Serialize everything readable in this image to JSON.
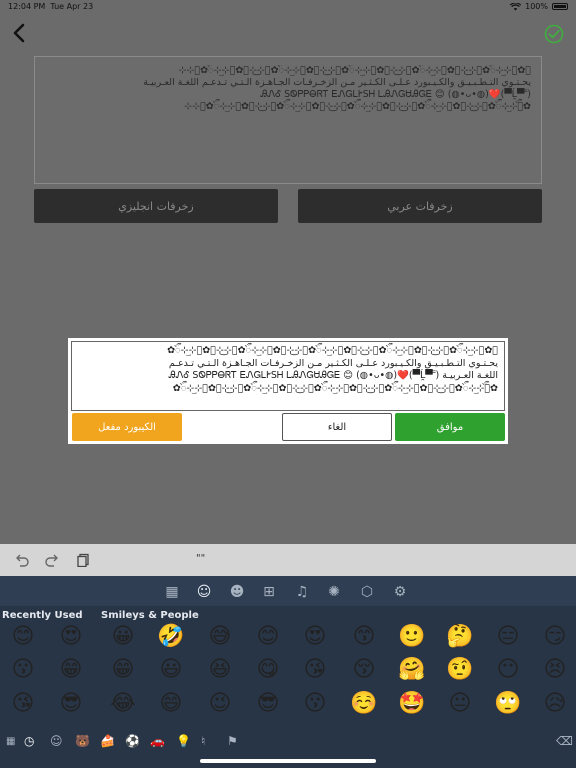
{
  "status": {
    "time": "12:04 PM",
    "date": "Tue Apr 23",
    "battery": "100%"
  },
  "editor": {
    "text": "✿ᭂ⊹⃝ٜ͜⊹ᭂ✿⊹⃝⊹͜✿ᭂ⊹⃝ٜ͜⊹ᭂ✿⊹⃝⊹͜✿ᭂ⊹⃝ٜ͜⊹ᭂ✿⊹⃝⊹͜✿ᭂ⊹⃝ٜ͜⊹ᭂ✿⊹⃝⊹͜✿ᭂ⊹⃝ٜ͜⊹ᭂ✿⊹⃝⊹\nيحـتـوي التـطـبـيـق والكـيـبورد عـلـى الكـثـير مـن الزخـرفـات الجـاهـزة الـتـي تـدعـم اللغـة العـربيـة\nᎯᏁᎴ ЅᏫᏢᏢᎾᏒᎢ ᎬᏁᏀᏞᎨЅᎻ ᏞᎯᏁᏀᏌᎯᏀᎬ 😊 (◍•ᴗ•◍)❤️(▀̿Ĺ̯▀̿ ̿)\n✿ᭂ⊹⃝ٜ͜⊹ᭂ✿⊹⃝⊹͜✿ᭂ⊹⃝ٜ͜⊹ᭂ✿⊹⃝⊹͜✿ᭂ⊹⃝ٜ͜⊹ᭂ✿⊹⃝⊹͜✿ᭂ⊹⃝ٜ͜⊹ᭂ✿⊹⃝⊹͜✿ᭂ⊹⃝ٜ͜⊹ᭂ✿⊹⃝⊹"
  },
  "buttons": {
    "english": "زخرفات انجليزي",
    "arabic": "زخرفات عربي"
  },
  "dialog": {
    "text": "✿ᭂ⊹⃝ٜ͜⊹ᭂ✿⊹⃝⊹͜✿ᭂ⊹⃝ٜ͜⊹ᭂ✿⊹⃝⊹͜✿ᭂ⊹⃝ٜ͜⊹ᭂ✿⊹⃝⊹͜✿ᭂ⊹⃝ٜ͜⊹ᭂ✿⊹⃝⊹͜✿ᭂ⊹⃝ٜ͜⊹ᭂ✿\nيحـتـوي التـطـبـيـق والكـيـبورد عـلـى الكـثـير مـن الزخـرفـات الجـاهـزة الـتـي تـدعـم\nاللغـة العـربيـة ᎯᏁᎴ ЅᏫᏢᏢᎾᏒᎢ ᎬᏁᏀᏞᎨЅᎻ ᏞᎯᏁᏀᏌᎯᏀᎬ 😊 (◍•ᴗ•◍)❤️(▀̿Ĺ̯▀̿ ̿)\n✿ᭂ⊹⃝ٜ͜⊹ᭂ✿⊹⃝⊹͜✿ᭂ⊹⃝ٜ͜⊹ᭂ✿⊹⃝⊹͜✿ᭂ⊹⃝ٜ͜⊹ᭂ✿⊹⃝⊹͜✿ᭂ⊹⃝ٜ͜⊹ᭂ✿⊹⃝⊹͜✿ᭂ⊹⃝ٜ͜⊹ᭂ✿",
    "ok": "موافق",
    "cancel": "الغاء",
    "keyboard_enabled": "الكيبورد مفعل"
  },
  "toolbar": {
    "quote": "\"\""
  },
  "keyboard": {
    "recent_label": "Recently Used",
    "smileys_label": "Smileys & People",
    "emojis": [
      [
        "😊",
        "😍",
        "😀",
        "🤣",
        "😅",
        "😊",
        "😍",
        "😙",
        "🙂",
        "🤔",
        "😑",
        "😏"
      ],
      [
        "😗",
        "😁",
        "😁",
        "😃",
        "😆",
        "😋",
        "😘",
        "😚",
        "🤗",
        "🤨",
        "😶",
        "😣"
      ],
      [
        "😘",
        "😎",
        "😂",
        "😄",
        "😉",
        "😎",
        "😗",
        "☺️",
        "🤩",
        "😐",
        "🙄",
        "😥"
      ]
    ]
  },
  "colors": {
    "ok_green": "#2ea12f",
    "keyboard_orange": "#f1a51e",
    "keyboard_bg": "#283546",
    "done_check_green": "#3fae3f"
  }
}
